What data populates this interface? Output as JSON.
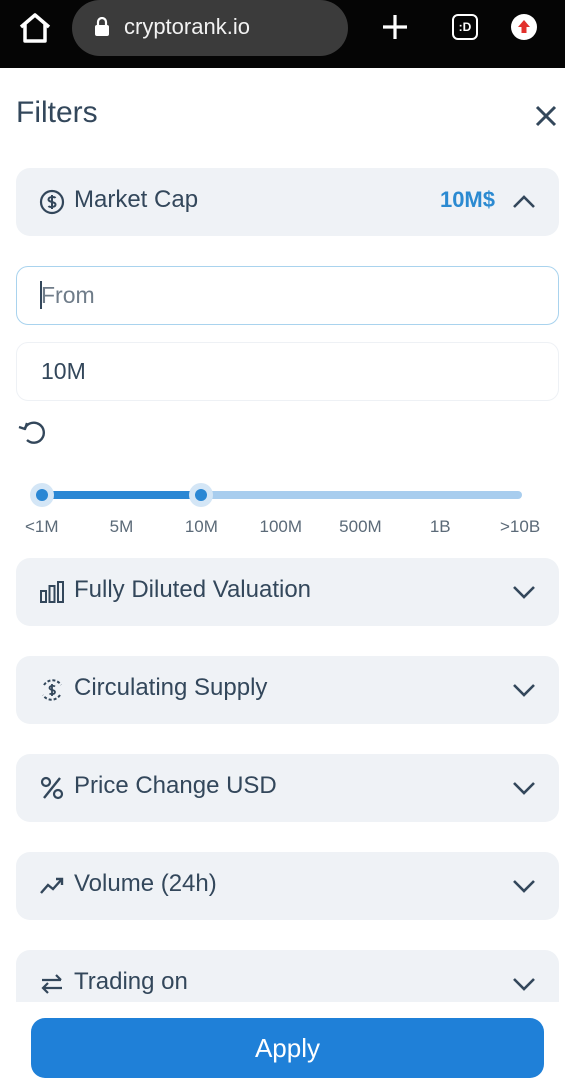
{
  "browser": {
    "url": "cryptorank.io",
    "tabs_label": ":D"
  },
  "filters": {
    "title": "Filters",
    "market_cap": {
      "label": "Market Cap",
      "value": "10M$",
      "from_placeholder": "From",
      "to_value": "10M",
      "slider": {
        "ticks": [
          "<1M",
          "5M",
          "10M",
          "100M",
          "500M",
          "1B",
          ">10B"
        ],
        "min_index": 0,
        "max_index": 2
      }
    },
    "sections": [
      {
        "label": "Fully Diluted Valuation",
        "icon": "bar-chart-icon"
      },
      {
        "label": "Circulating Supply",
        "icon": "circulating-coin-icon"
      },
      {
        "label": "Price Change USD",
        "icon": "percent-icon"
      },
      {
        "label": "Volume (24h)",
        "icon": "trend-line-icon"
      },
      {
        "label": "Trading on",
        "icon": "swap-arrows-icon"
      }
    ],
    "apply_label": "Apply"
  },
  "colors": {
    "accent": "#1f80d8",
    "value_text": "#2b8ad1",
    "section_bg": "#eff2f6",
    "text": "#33475b"
  }
}
